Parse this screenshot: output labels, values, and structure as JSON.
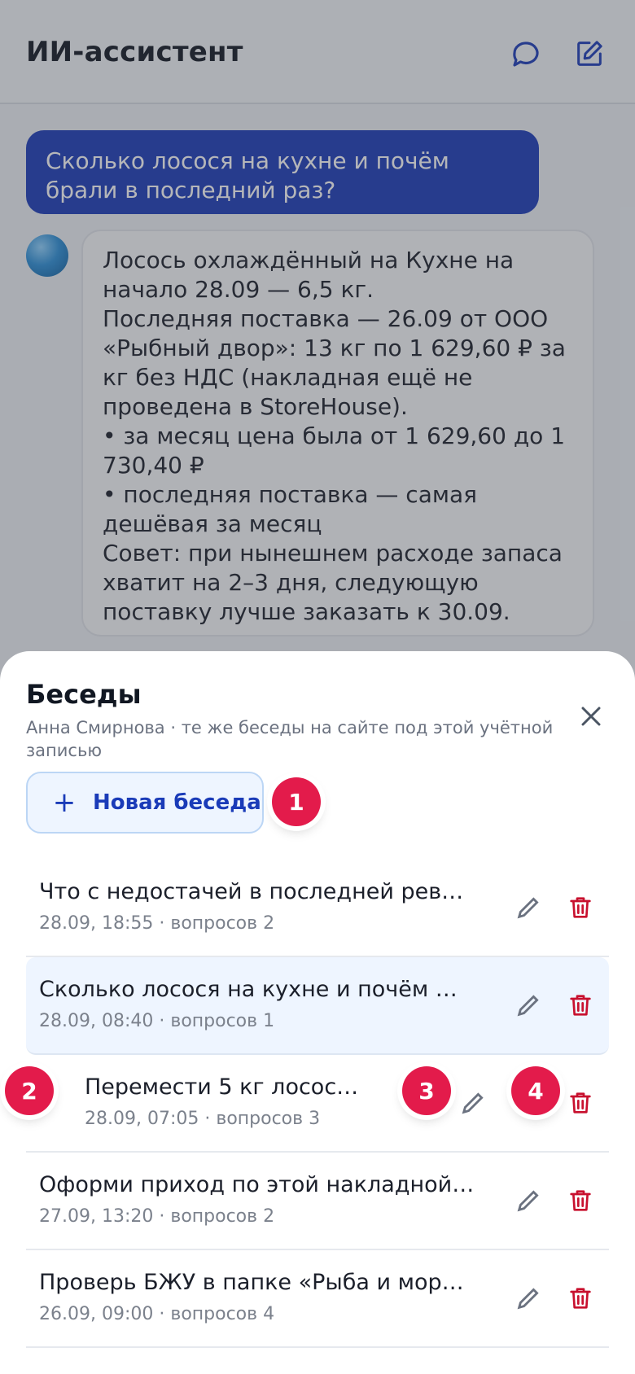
{
  "header": {
    "title": "ИИ-ассистент",
    "chats_icon": "chat-bubble-icon",
    "compose_icon": "compose-icon"
  },
  "chat": {
    "user_message": "Сколько лосося на кухне и почём брали в последний раз?",
    "bot_lines": [
      "Лосось охлаждённый на Кухне на начало 28.09 — 6,5 кг.",
      "Последняя поставка — 26.09 от ООО «Рыбный двор»: 13 кг по 1 629,60 ₽ за кг без НДС (накладная ещё не проведена в StoreHouse).",
      "• за месяц цена была от 1 629,60 до 1 730,40 ₽",
      "• последняя поставка — самая дешёвая за месяц",
      "Совет: при нынешнем расходе запаса хватит на 2–3 дня, следующую поставку лучше заказать к 30.09."
    ]
  },
  "sheet": {
    "title": "Беседы",
    "subtitle": "Анна Смирнова · те же беседы на сайте под этой учётной записью",
    "new_button_label": "Новая беседа",
    "conversations": [
      {
        "title": "Что с недостачей в последней рев…",
        "meta": "28.09, 18:55 · вопросов 2"
      },
      {
        "title": "Сколько лосося на кухне и почём …",
        "meta": "28.09, 08:40 · вопросов 1",
        "active": true
      },
      {
        "title": "Перемести 5 кг лосос…",
        "meta": "28.09, 07:05 · вопросов 3"
      },
      {
        "title": "Оформи приход по этой накладной…",
        "meta": "27.09, 13:20 · вопросов 2"
      },
      {
        "title": "Проверь БЖУ в папке «Рыба и мор…",
        "meta": "26.09, 09:00 · вопросов 4"
      }
    ]
  },
  "markers": [
    "1",
    "2",
    "3",
    "4"
  ],
  "colors": {
    "accent": "#1a3bb8",
    "delete": "#c8102e",
    "marker": "#e31b4b",
    "active_row": "#eef5ff"
  }
}
